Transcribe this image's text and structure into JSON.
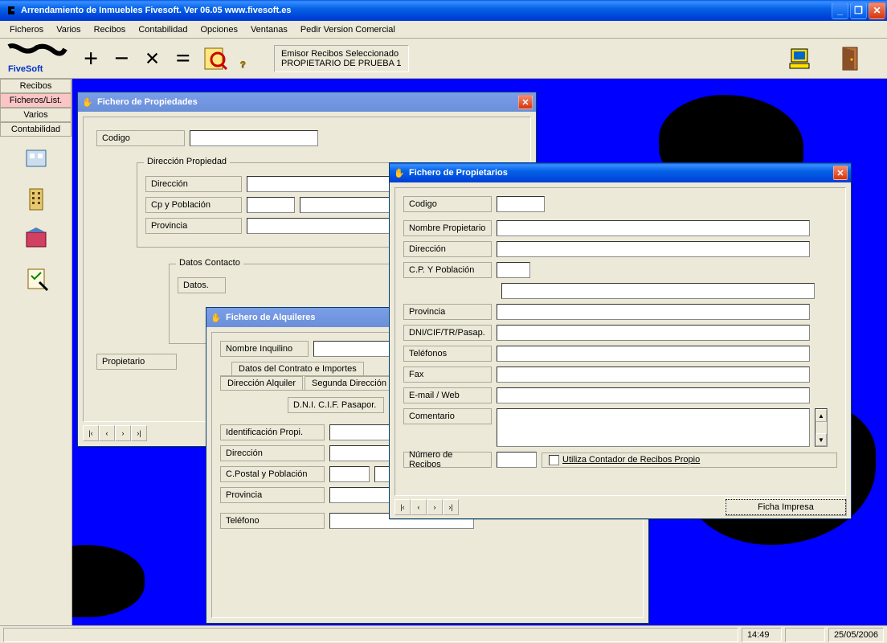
{
  "app": {
    "title": "Arrendamiento de Inmuebles Fivesoft. Ver 06.05 www.fivesoft.es"
  },
  "menubar": {
    "items": [
      "Ficheros",
      "Varios",
      "Recibos",
      "Contabilidad",
      "Opciones",
      "Ventanas",
      "Pedir Version Comercial"
    ]
  },
  "toolbar": {
    "emisor_line1": "Emisor Recibos Seleccionado",
    "emisor_line2": "PROPIETARIO DE PRUEBA 1"
  },
  "sidebar": {
    "tabs": [
      "Recibos",
      "Ficheros/List.",
      "Varios",
      "Contabilidad"
    ],
    "active_index": 1
  },
  "win_propiedades": {
    "title": "Fichero de Propiedades",
    "codigo_label": "Codigo",
    "fieldset_direccion": "Dirección Propiedad",
    "direccion_label": "Dirección",
    "cp_label": "Cp y Población",
    "provincia_label": "Provincia",
    "fieldset_contacto": "Datos Contacto",
    "datos_label": "Datos.",
    "propietario_label": "Propietario"
  },
  "win_alquileres": {
    "title": "Fichero de Alquileres",
    "nombre_label": "Nombre Inquilino",
    "tab1": "Datos del Contrato e Importes",
    "tab2": "Dirección Alquiler",
    "tab3": "Segunda Dirección",
    "dni_label": "D.N.I. C.I.F. Pasapor.",
    "ident_label": "Identificación Propi.",
    "direccion_label": "Dirección",
    "cp_label": "C.Postal y Población",
    "provincia_label": "Provincia",
    "telefono_label": "Teléfono"
  },
  "win_propietarios": {
    "title": "Fichero de Propietarios",
    "codigo_label": "Codigo",
    "nombre_label": "Nombre Propietario",
    "direccion_label": "Dirección",
    "cp_label": "C.P. Y Población",
    "provincia_label": "Provincia",
    "dni_label": "DNI/CIF/TR/Pasap.",
    "telefonos_label": "Teléfonos",
    "fax_label": "Fax",
    "email_label": "E-mail / Web",
    "comentario_label": "Comentario",
    "num_recibos_label": "Número de Recibos",
    "checkbox_label": "Utiliza Contador de Recibos Propio",
    "ficha_btn": "Ficha Impresa"
  },
  "nav": {
    "first": "|‹",
    "prev": "‹",
    "next": "›",
    "last": "›|"
  },
  "statusbar": {
    "time": "14:49",
    "date": "25/05/2006"
  }
}
